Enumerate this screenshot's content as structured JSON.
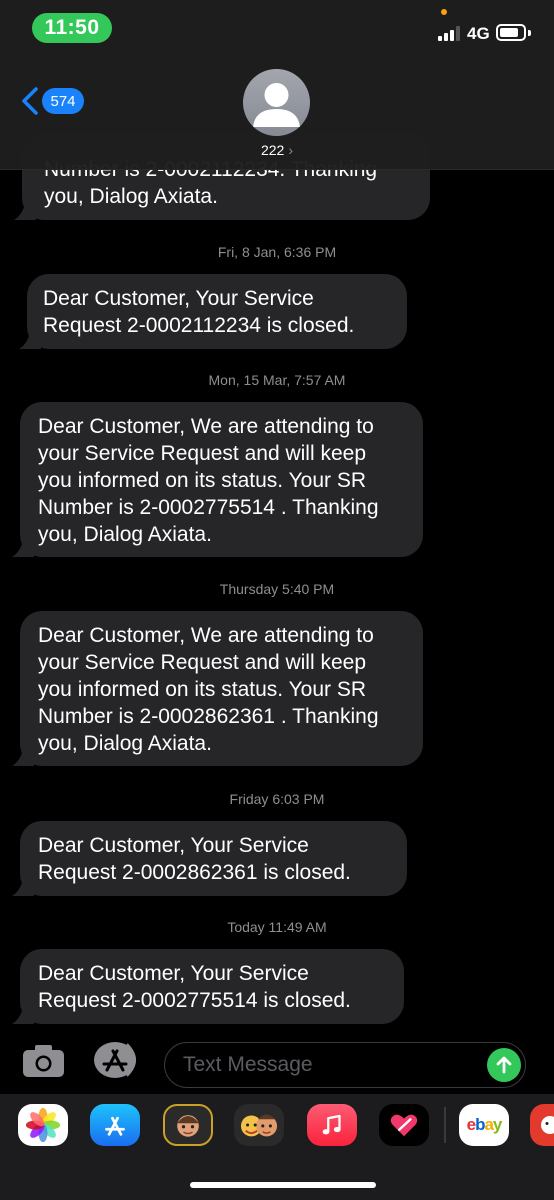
{
  "status_bar": {
    "time": "11:50",
    "network": "4G"
  },
  "header": {
    "unread_count": "574",
    "contact_name": "222"
  },
  "messages": [
    {
      "text": "Number is 2-0002112234. Thanking you, Dialog Axiata."
    },
    {
      "text": "Dear Customer, Your Service Request 2-0002112234 is closed."
    },
    {
      "text": "Dear Customer, We are attending to your Service Request and will keep you informed on its status. Your SR Number is 2-0002775514 . Thanking you, Dialog Axiata."
    },
    {
      "text": "Dear Customer, We are attending to your Service Request and will keep you informed on its status. Your SR Number is 2-0002862361 . Thanking you, Dialog Axiata."
    },
    {
      "text": "Dear Customer, Your Service Request 2-0002862361 is closed."
    },
    {
      "text": "Dear Customer, Your Service Request 2-0002775514 is closed."
    }
  ],
  "timestamps": [
    {
      "label": "Fri, 8 Jan, 6:36 PM"
    },
    {
      "label": "Mon, 15 Mar, 7:57 AM"
    },
    {
      "label": "Thursday 5:40 PM"
    },
    {
      "label": "Friday 6:03 PM"
    },
    {
      "label": "Today 11:49 AM"
    }
  ],
  "composer": {
    "placeholder": "Text Message"
  },
  "app_drawer": {
    "apps": [
      {
        "name": "photos-icon"
      },
      {
        "name": "app-store-icon"
      },
      {
        "name": "memoji-icon"
      },
      {
        "name": "memoji-stickers-icon"
      },
      {
        "name": "music-icon"
      },
      {
        "name": "digital-touch-icon"
      },
      {
        "name": "ebay-icon",
        "label": "ebay"
      },
      {
        "name": "sticker-app-icon"
      }
    ]
  },
  "colors": {
    "accent_blue": "#1a82fb",
    "send_green": "#34c759",
    "bubble_gray": "#262628"
  }
}
